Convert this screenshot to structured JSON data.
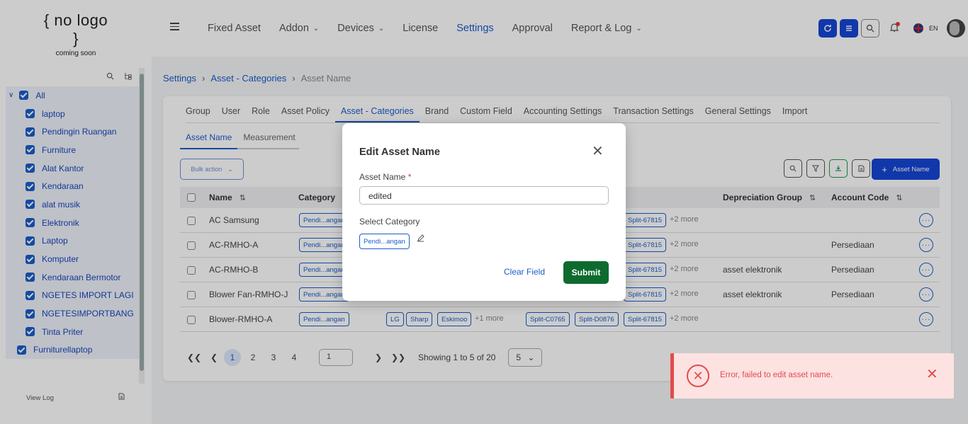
{
  "header": {
    "logo_line1": "{ no logo }",
    "logo_line2": "coming soon",
    "nav": [
      {
        "label": "Fixed Asset",
        "chevron": false
      },
      {
        "label": "Addon",
        "chevron": true
      },
      {
        "label": "Devices",
        "chevron": true
      },
      {
        "label": "License",
        "chevron": false
      },
      {
        "label": "Settings",
        "chevron": false,
        "active": true
      },
      {
        "label": "Approval",
        "chevron": false
      },
      {
        "label": "Report & Log",
        "chevron": true
      }
    ],
    "lang": "EN"
  },
  "sidebar": {
    "root_label": "All",
    "items": [
      "laptop",
      "Pendingin Ruangan",
      "Furniture",
      "Alat Kantor",
      "Kendaraan",
      "alat musik",
      "Elektronik",
      "Laptop",
      "Komputer",
      "Kendaraan Bermotor",
      "NGETES IMPORT LAGI",
      "NGETESIMPORTBANG",
      "Tinta Priter"
    ],
    "last_label": "Furniturellaptop",
    "view_log": "View Log"
  },
  "breadcrumb": {
    "b1": "Settings",
    "b2": "Asset - Categories",
    "b3": "Asset Name"
  },
  "tabs": [
    "Group",
    "User",
    "Role",
    "Asset Policy",
    "Asset - Categories",
    "Brand",
    "Custom Field",
    "Accounting Settings",
    "Transaction Settings",
    "General Settings",
    "Import"
  ],
  "active_tab": "Asset - Categories",
  "subtabs": [
    "Asset Name",
    "Measurement"
  ],
  "toolbar": {
    "bulk": "Bulk action",
    "add": "Asset Name"
  },
  "table": {
    "headers": {
      "name": "Name",
      "category": "Category",
      "depreciation": "Depreciation Group",
      "account": "Account Code"
    },
    "rows": [
      {
        "name": "AC Samsung",
        "category": "Pendi...angan",
        "brands": [],
        "brand_more": "",
        "models": [
          "Split-67815"
        ],
        "model_more": "+2 more",
        "depreciation": "",
        "account": ""
      },
      {
        "name": "AC-RMHO-A",
        "category": "Pendi...angan",
        "brands": [],
        "brand_more": "",
        "models": [
          "Split-67815"
        ],
        "model_more": "+2 more",
        "depreciation": "",
        "account": "Persediaan"
      },
      {
        "name": "AC-RMHO-B",
        "category": "Pendi...angan",
        "brands": [],
        "brand_more": "",
        "models": [
          "Split-67815"
        ],
        "model_more": "+2 more",
        "depreciation": "asset elektronik",
        "account": "Persediaan"
      },
      {
        "name": "Blower Fan-RMHO-J",
        "category": "Pendi...angan",
        "brands": [],
        "brand_more": "",
        "models": [
          "Split-67815"
        ],
        "model_more": "+2 more",
        "depreciation": "asset elektronik",
        "account": "Persediaan"
      },
      {
        "name": "Blower-RMHO-A",
        "category": "Pendi...angan",
        "brands": [
          "LG",
          "Sharp",
          "Eskimoo"
        ],
        "brand_more": "+1 more",
        "models": [
          "Split-C0765",
          "Split-D0876",
          "Split-67815"
        ],
        "model_more": "+2 more",
        "depreciation": "",
        "account": ""
      }
    ]
  },
  "pager": {
    "pages": [
      "1",
      "2",
      "3",
      "4"
    ],
    "current": "1",
    "goto": "1",
    "showing": "Showing 1 to 5 of 20",
    "per_page": "5"
  },
  "modal": {
    "title": "Edit Asset Name",
    "name_label": "Asset Name",
    "required": "*",
    "name_value": "edited",
    "category_label": "Select Category",
    "category_chip": "Pendi...angan",
    "clear": "Clear Field",
    "submit": "Submit"
  },
  "toast": {
    "message": "Error, failed to edit asset name.",
    "color": "#e34b4b"
  }
}
